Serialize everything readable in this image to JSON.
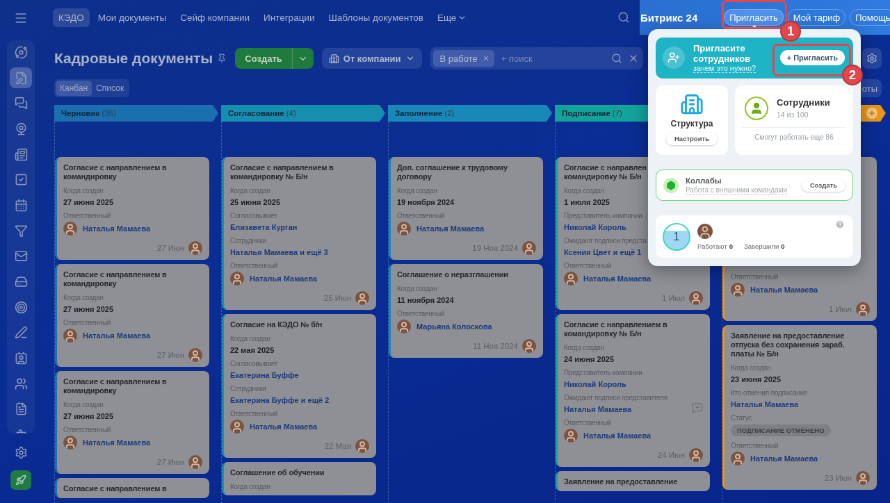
{
  "sidebar": {
    "items": [
      {
        "selected": false
      },
      {
        "selected": true
      },
      {
        "selected": false
      },
      {
        "selected": false
      },
      {
        "selected": false
      },
      {
        "selected": false
      },
      {
        "selected": false
      },
      {
        "selected": false
      },
      {
        "selected": false
      },
      {
        "selected": false
      },
      {
        "selected": false
      },
      {
        "selected": false
      },
      {
        "selected": false
      },
      {
        "selected": false
      },
      {
        "selected": false
      },
      {
        "selected": false
      }
    ]
  },
  "topnav": {
    "tabs": [
      {
        "label": "КЭДО",
        "selected": true,
        "kind": "tab"
      },
      {
        "label": "Мои документы",
        "selected": false,
        "kind": "tab"
      },
      {
        "label": "Сейф компании",
        "selected": false,
        "kind": "tab"
      },
      {
        "label": "Интеграции",
        "selected": false,
        "kind": "tab"
      },
      {
        "label": "Шаблоны документов",
        "selected": false,
        "kind": "tab"
      },
      {
        "label": "Еще",
        "selected": false,
        "kind": "menu"
      }
    ]
  },
  "header": {
    "brand": "Битрикс 24",
    "buttons": [
      {
        "label": "Пригласить",
        "selected": true
      },
      {
        "label": "Мой тариф",
        "selected": false
      },
      {
        "label": "Помощь",
        "selected": false
      }
    ]
  },
  "toolbar": {
    "title": "Кадровые документы",
    "create_button": "Создать",
    "company_filter": "От компании",
    "filter_chip": "В работе",
    "search_placeholder": "+ поиск",
    "side_button": "оты"
  },
  "views": [
    {
      "label": "Канбан",
      "selected": true
    },
    {
      "label": "Список",
      "selected": false
    }
  ],
  "columns": [
    {
      "name": "Черновик",
      "count": "(35)",
      "color": "#1b6fae",
      "add_button": false,
      "cards": [
        {
          "title": "Согласие с направлением в командировку",
          "fields": [
            {
              "label": "Когда создан",
              "value": "27 июня 2025",
              "kind": "date"
            },
            {
              "label": "Ответственный",
              "value": "Наталья Мамаева",
              "kind": "person"
            }
          ],
          "date": "27 Июн"
        },
        {
          "title": "Согласие с направлением в командировку",
          "fields": [
            {
              "label": "Когда создан",
              "value": "27 июня 2025",
              "kind": "date"
            },
            {
              "label": "Ответственный",
              "value": "Наталья Мамаева",
              "kind": "person"
            }
          ],
          "date": "27 Июн"
        },
        {
          "title": "Согласие с направлением в командировку",
          "fields": [
            {
              "label": "Когда создан",
              "value": "27 июня 2025",
              "kind": "date"
            },
            {
              "label": "Ответственный",
              "value": "Наталья Мамаева",
              "kind": "person"
            }
          ],
          "date": "27 Июн"
        },
        {
          "title": "Согласие с направлением в"
        }
      ]
    },
    {
      "name": "Согласование",
      "count": "(4)",
      "color": "#168fae",
      "add_button": false,
      "cards": [
        {
          "title": "Согласие с направлением в командировку № Б/н",
          "fields": [
            {
              "label": "Когда создан",
              "value": "25 июня 2025",
              "kind": "date"
            },
            {
              "label": "Согласовывает",
              "value": "Елизавета Курган",
              "kind": "link"
            },
            {
              "label": "Сотрудники",
              "value": "Наталья Мамаева и ещё 3",
              "kind": "link"
            },
            {
              "label": "Ответственный",
              "value": "Наталья Мамаева",
              "kind": "person"
            }
          ],
          "date": "25 Июн"
        },
        {
          "title": "Согласие на КЭДО № б/н",
          "fields": [
            {
              "label": "Когда создан",
              "value": "22 мая 2025",
              "kind": "date"
            },
            {
              "label": "Согласовывает",
              "value": "Екатерина Буффе",
              "kind": "link"
            },
            {
              "label": "Сотрудники",
              "value": "Екатерина Буффе и ещё 2",
              "kind": "link"
            },
            {
              "label": "Ответственный",
              "value": "Наталья Мамаева",
              "kind": "person"
            }
          ],
          "date": "22 Мая"
        },
        {
          "title": "Соглашение об обучении",
          "fields": [
            {
              "label": "Когда создан"
            }
          ]
        }
      ]
    },
    {
      "name": "Заполнение",
      "count": "(2)",
      "color": "#1788b8",
      "add_button": false,
      "cards": [
        {
          "title": "Доп. соглашение к трудовому договору",
          "fields": [
            {
              "label": "Когда создан",
              "value": "19 ноября 2024",
              "kind": "date"
            },
            {
              "label": "Ответственный",
              "value": "Наталья Мамаева",
              "kind": "person"
            }
          ],
          "date": "19 Ноя 2024"
        },
        {
          "title": "Соглашение о неразглашении",
          "fields": [
            {
              "label": "Когда создан",
              "value": "11 ноября 2024",
              "kind": "date"
            },
            {
              "label": "Ответственный",
              "value": "Марьяна Колоскова",
              "kind": "person"
            }
          ],
          "date": "11 Ноя 2024"
        }
      ]
    },
    {
      "name": "Подписание",
      "count": "(7)",
      "color": "#14a29c",
      "add_button": false,
      "cards": [
        {
          "title": "Согласие с направлен\nкомандировку № Б/н",
          "fields": [
            {
              "label": "Когда создан",
              "value": "1 июля 2025",
              "kind": "date"
            },
            {
              "label": "Представитель компании",
              "value": "Николай Король",
              "kind": "link"
            },
            {
              "label": "Ожидают подписи предста",
              "value": "Ксения Цвет и ещё 1",
              "kind": "link"
            },
            {
              "label": "Ответственный",
              "value": "Наталья Мамаева",
              "kind": "person"
            }
          ],
          "date": "1 Июл"
        },
        {
          "title": "Согласие с направлением в командировку № Б/н",
          "fields": [
            {
              "label": "Когда создан",
              "value": "24 июня 2025",
              "kind": "date"
            },
            {
              "label": "Представитель компании",
              "value": "Николай Король",
              "kind": "link"
            },
            {
              "label": "Ожидают подписи представителя",
              "value": "Наталья Мамаева",
              "kind": "link_action"
            },
            {
              "label": "Ответственный",
              "value": "Наталья Мамаева",
              "kind": "person"
            }
          ],
          "date": "24 Июн"
        },
        {
          "title": "Заявление на предоставление"
        }
      ]
    },
    {
      "color": "#e8951a",
      "add_button": true,
      "cards": [
        {
          "fields": [
            {
              "label": "Ответственный",
              "value": "Наталья Мамаева",
              "kind": "person"
            }
          ],
          "date": "1 Июл"
        },
        {
          "title": "Заявление на предоставление отпуска без сохранения зараб. платы № Б/н",
          "fields": [
            {
              "label": "Когда создан",
              "value": "23 июня 2025",
              "kind": "date"
            },
            {
              "label": "Кто отменил подписание",
              "value": "Наталья Мамаева",
              "kind": "link"
            },
            {
              "label": "Статус",
              "value": "ПОДПИСАНИЕ ОТМЕНЕНО",
              "kind": "badge"
            },
            {
              "label": "Ответственный",
              "value": "Наталья Мамаева",
              "kind": "person"
            }
          ],
          "date": "23 Июн"
        }
      ]
    }
  ],
  "popup": {
    "invite": {
      "title": "Пригласите сотрудников",
      "link": "зачем это нужно?",
      "button": "+ Пригласить"
    },
    "structure": {
      "title": "Структура",
      "button": "Настроить"
    },
    "employees": {
      "title": "Сотрудники",
      "count": "14 из 100",
      "note": "Смогут работать еще 86"
    },
    "collabs": {
      "title": "Коллабы",
      "subtitle": "Работа с внешними командами",
      "button": "Создать"
    },
    "stats": {
      "number": "1",
      "items": [
        {
          "label": "Работают",
          "value": "0"
        },
        {
          "label": "Завершили",
          "value": "0"
        }
      ]
    }
  },
  "annotations": [
    {
      "label": "1"
    },
    {
      "label": "2"
    }
  ]
}
